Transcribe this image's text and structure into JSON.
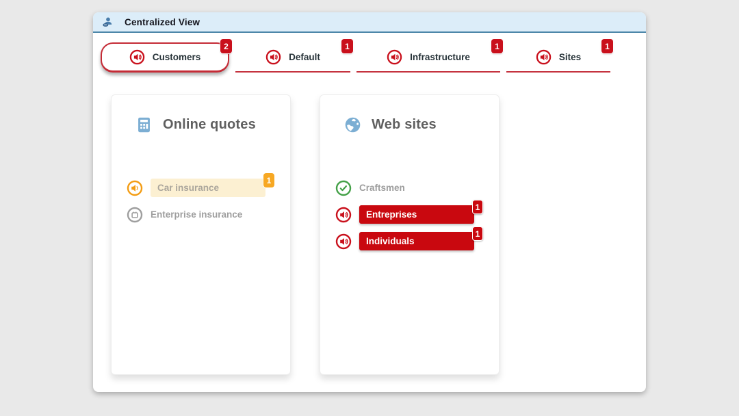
{
  "window": {
    "title": "Centralized View"
  },
  "tabs": [
    {
      "label": "Customers",
      "badge": "2",
      "state": "active",
      "icon": "speaker-icon"
    },
    {
      "label": "Default",
      "badge": "1",
      "state": "inactive",
      "icon": "speaker-icon"
    },
    {
      "label": "Infrastructure",
      "badge": "1",
      "state": "inactive",
      "icon": "speaker-icon"
    },
    {
      "label": "Sites",
      "badge": "1",
      "state": "inactive",
      "icon": "speaker-icon"
    }
  ],
  "cards": [
    {
      "title": "Online quotes",
      "icon": "calculator-icon",
      "items": [
        {
          "label": "Car insurance",
          "badge": "1",
          "status": "warning",
          "icon": "speaker-icon"
        },
        {
          "label": "Enterprise insurance",
          "badge": "",
          "status": "scheduled",
          "icon": "calendar-icon"
        }
      ]
    },
    {
      "title": "Web sites",
      "icon": "globe-icon",
      "items": [
        {
          "label": "Craftsmen",
          "badge": "",
          "status": "ok",
          "icon": "check-icon"
        },
        {
          "label": "Entreprises",
          "badge": "1",
          "status": "critical",
          "icon": "speaker-icon"
        },
        {
          "label": "Individuals",
          "badge": "1",
          "status": "critical",
          "icon": "speaker-icon"
        }
      ]
    }
  ],
  "colors": {
    "critical_red": "#c9080f",
    "badge_red": "#c9101c",
    "tab_border_red": "#c52b36",
    "warning_orange": "#f7a823",
    "warning_bg": "#fcf0d2",
    "ok_green": "#43a047",
    "icon_blue": "#7caed3",
    "titlebar_bg": "#dcedf9",
    "titlebar_border": "#4d87a9",
    "muted_gray": "#9e9e9e"
  }
}
